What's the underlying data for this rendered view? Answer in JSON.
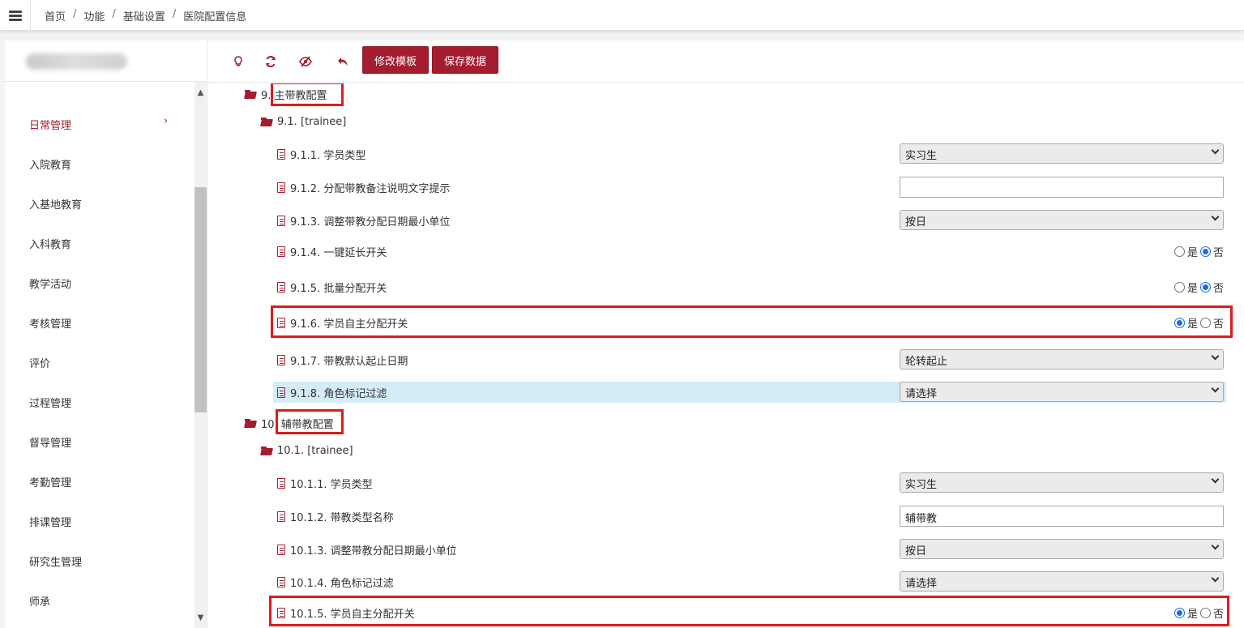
{
  "header": {
    "breadcrumb": [
      "首页",
      "功能",
      "基础设置",
      "医院配置信息"
    ]
  },
  "sidebar": {
    "items": [
      {
        "label": "日常管理",
        "active": true
      },
      {
        "label": "入院教育"
      },
      {
        "label": "入基地教育"
      },
      {
        "label": "入科教育"
      },
      {
        "label": "教学活动"
      },
      {
        "label": "考核管理"
      },
      {
        "label": "评价"
      },
      {
        "label": "过程管理"
      },
      {
        "label": "督导管理"
      },
      {
        "label": "考勤管理"
      },
      {
        "label": "排课管理"
      },
      {
        "label": "研究生管理"
      },
      {
        "label": "师承"
      }
    ],
    "active_arrow": "›"
  },
  "toolbar": {
    "icons": [
      "lightbulb-icon",
      "refresh-icon",
      "eye-slash-icon",
      "undo-icon"
    ],
    "edit_template_label": "修改模板",
    "save_data_label": "保存数据"
  },
  "config": {
    "section9": {
      "title": "9. 主带教配置",
      "group": "9.1. [trainee]",
      "items": [
        {
          "label": "9.1.1. 学员类型",
          "type": "select",
          "value": "实习生"
        },
        {
          "label": "9.1.2. 分配带教备注说明文字提示",
          "type": "input",
          "value": ""
        },
        {
          "label": "9.1.3. 调整带教分配日期最小单位",
          "type": "select",
          "value": "按日"
        },
        {
          "label": "9.1.4. 一键延长开关",
          "type": "radio",
          "value": "否"
        },
        {
          "label": "9.1.5. 批量分配开关",
          "type": "radio",
          "value": "否"
        },
        {
          "label": "9.1.6. 学员自主分配开关",
          "type": "radio",
          "value": "是"
        },
        {
          "label": "9.1.7. 带教默认起止日期",
          "type": "select",
          "value": "轮转起止"
        },
        {
          "label": "9.1.8. 角色标记过滤",
          "type": "select",
          "value": "请选择"
        }
      ]
    },
    "section10": {
      "title": "10. 辅带教配置",
      "group": "10.1. [trainee]",
      "items": [
        {
          "label": "10.1.1. 学员类型",
          "type": "select",
          "value": "实习生"
        },
        {
          "label": "10.1.2. 带教类型名称",
          "type": "input",
          "value": "辅带教"
        },
        {
          "label": "10.1.3. 调整带教分配日期最小单位",
          "type": "select",
          "value": "按日"
        },
        {
          "label": "10.1.4. 角色标记过滤",
          "type": "select",
          "value": "请选择"
        },
        {
          "label": "10.1.5. 学员自主分配开关",
          "type": "radio",
          "value": "是"
        }
      ]
    },
    "radio_options": {
      "yes": "是",
      "no": "否"
    }
  },
  "colors": {
    "accent": "#a41d2e",
    "highlight_row": "#d4ebf8",
    "annotation_box": "#e01b1b"
  }
}
